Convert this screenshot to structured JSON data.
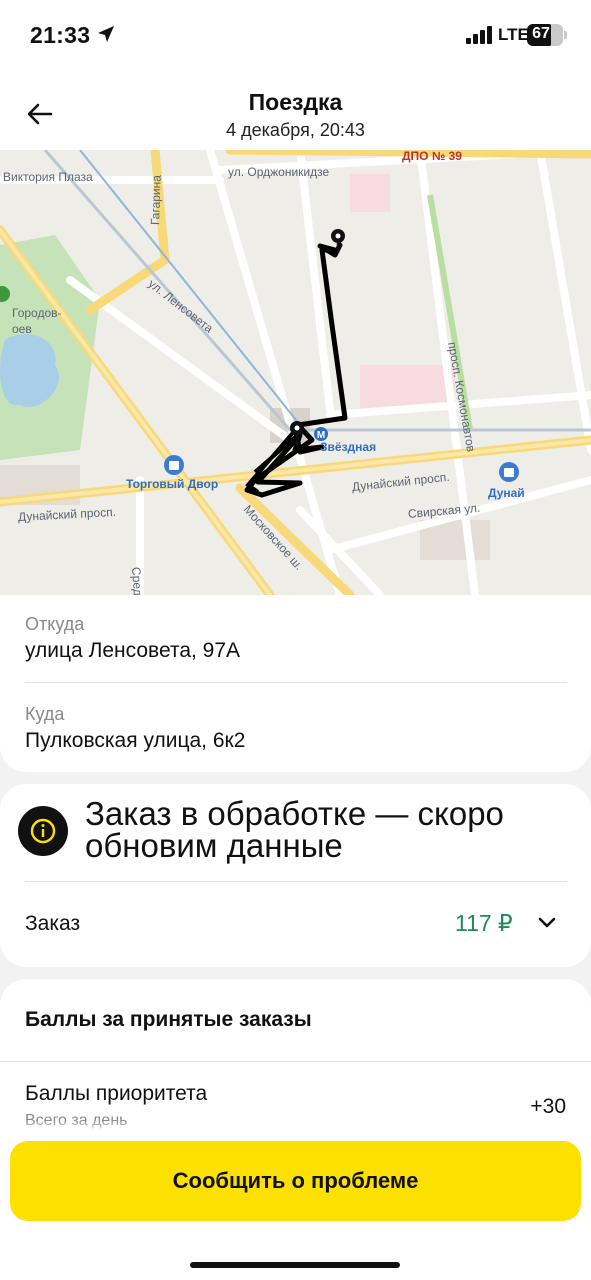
{
  "status_bar": {
    "time": "21:33",
    "network": "LTE",
    "battery_percent": "67",
    "battery_level": 0.67
  },
  "header": {
    "title": "Поездка",
    "subtitle": "4 декабря, 20:43",
    "back_icon": "arrow-left-icon"
  },
  "map": {
    "labels": {
      "ordzhonikidze": "ул. Орджоникидзе",
      "dpo": "ДПО № 39",
      "viktoria": "Виктория Плаза",
      "gagarina": "Гагарина",
      "lensoveta": "ул. Ленсовета",
      "park": "Городов-\nоев",
      "kosmonavtov": "просп. Космонавтов",
      "metro": "Звёздная",
      "torgovy_dvor": "Торговый Двор",
      "dunaisky_mid": "Дунайский просп.",
      "dunai_store": "Дунай",
      "dunaisky_left": "Дунайский просп.",
      "svirskaya": "Свирская ул.",
      "moskovskoe": "Московское ш.",
      "srednyaya": "Средне..."
    },
    "icons": [
      "map-pin-icon",
      "metro-icon",
      "shopping-bag-icon"
    ]
  },
  "trip": {
    "from_label": "Откуда",
    "from_value": "улица Ленсовета, 97А",
    "to_label": "Куда",
    "to_value": "Пулковская улица, 6к2"
  },
  "order_status": {
    "icon": "info-icon",
    "text": "Заказ в обработке — скоро обновим данные",
    "order_label": "Заказ",
    "order_price": "117 ₽",
    "price_color": "#1f8a5a"
  },
  "points": {
    "title": "Баллы за принятые заказы",
    "priority_label": "Баллы приоритета",
    "priority_sub": "Всего за день",
    "priority_value": "+30"
  },
  "actions": {
    "report_button": "Сообщить о проблеме",
    "accent": "#fce000"
  }
}
